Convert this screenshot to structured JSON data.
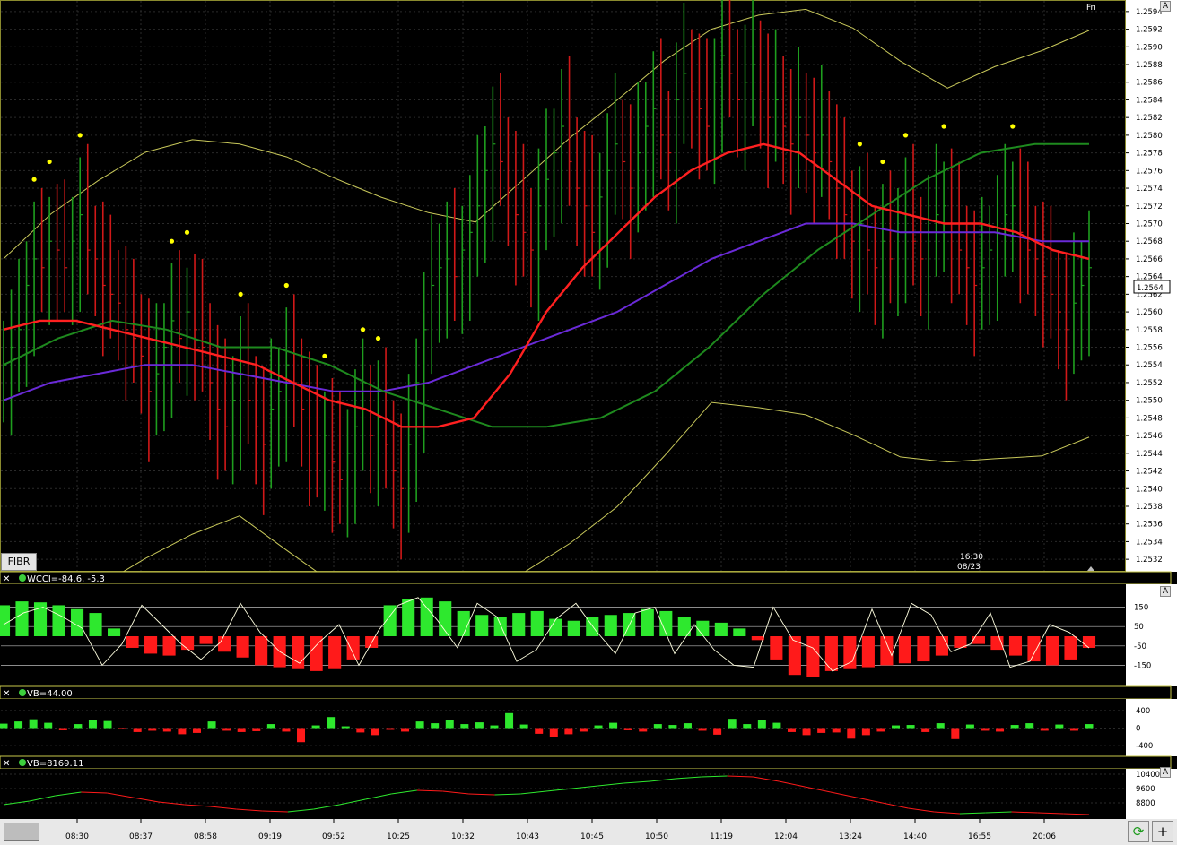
{
  "toolbar": {
    "tab_label": "FIBR",
    "corner_label": "A",
    "day_label": "Fri",
    "refresh_icon": "refresh-icon",
    "plus_label": "+"
  },
  "cursor": {
    "time": "16:30",
    "date": "08/23",
    "price_marker": "1.2564"
  },
  "colors": {
    "background": "#000000",
    "grid": "#2a2a2a",
    "up_bar": "#1e9e1e",
    "down_bar": "#d01818",
    "fast_ma": "#ff2020",
    "slow_ma": "#1e8a1e",
    "long_ma": "#6a2ad8",
    "bands": "#c8c85a",
    "dots": "#ffff00",
    "cci_line": "#ffffe0",
    "hist_up": "#2ee82e",
    "hist_down": "#ff1a1a"
  },
  "chart_data": [
    {
      "type": "line",
      "name": "price",
      "y_ticks": [
        "1.2594",
        "1.2592",
        "1.2590",
        "1.2588",
        "1.2586",
        "1.2584",
        "1.2582",
        "1.2580",
        "1.2578",
        "1.2576",
        "1.2574",
        "1.2572",
        "1.2570",
        "1.2568",
        "1.2566",
        "1.2564",
        "1.2562",
        "1.2560",
        "1.2558",
        "1.2556",
        "1.2554",
        "1.2552",
        "1.2550",
        "1.2548",
        "1.2546",
        "1.2544",
        "1.2542",
        "1.2540",
        "1.2538",
        "1.2536",
        "1.2534",
        "1.2532"
      ],
      "x_ticks": [
        "08:30",
        "08:37",
        "08:58",
        "09:19",
        "09:52",
        "10:25",
        "10:32",
        "10:43",
        "10:45",
        "10:50",
        "11:19",
        "12:04",
        "13:24",
        "14:40",
        "16:55",
        "20:06"
      ],
      "ylim": [
        1.2531,
        1.2595
      ],
      "close": [
        1.2554,
        1.2556,
        1.2558,
        1.2563,
        1.2566,
        1.2565,
        1.2568,
        1.2567,
        1.2565,
        1.2568,
        1.2571,
        1.2567,
        1.2566,
        1.2563,
        1.2562,
        1.2561,
        1.2558,
        1.2557,
        1.2555,
        1.2551,
        1.2553,
        1.2556,
        1.2559,
        1.2557,
        1.256,
        1.2558,
        1.2556,
        1.2552,
        1.2549,
        1.2547,
        1.255,
        1.2553,
        1.255,
        1.2547,
        1.2545,
        1.2549,
        1.2551,
        1.2554,
        1.2552,
        1.2549,
        1.2546,
        1.2544,
        1.2546,
        1.2543,
        1.2541,
        1.2544,
        1.2547,
        1.2549,
        1.2546,
        1.2548,
        1.2545,
        1.2542,
        1.254,
        1.2545,
        1.2552,
        1.2558,
        1.2563,
        1.2565,
        1.2566,
        1.2564,
        1.2567,
        1.2569,
        1.2572,
        1.2576,
        1.2579,
        1.2577,
        1.2574,
        1.2571,
        1.2569,
        1.2567,
        1.2572,
        1.2575,
        1.2578,
        1.2581,
        1.2577,
        1.2574,
        1.2572,
        1.2569,
        1.2573,
        1.2576,
        1.2579,
        1.2577,
        1.2574,
        1.2578,
        1.2581,
        1.2583,
        1.258,
        1.2578,
        1.2584,
        1.2587,
        1.2585,
        1.2583,
        1.2581,
        1.2586,
        1.2589,
        1.2587,
        1.2584,
        1.2586,
        1.2588,
        1.2585,
        1.2582,
        1.2584,
        1.2581,
        1.2579,
        1.2582,
        1.258,
        1.2578,
        1.258,
        1.2577,
        1.2574,
        1.2571,
        1.2568,
        1.257,
        1.2567,
        1.2565,
        1.2568,
        1.2566,
        1.2569,
        1.2571,
        1.2568,
        1.2566,
        1.2569,
        1.2571,
        1.2572,
        1.2569,
        1.2567,
        1.2565,
        1.2563,
        1.2565,
        1.2567,
        1.2569,
        1.2571,
        1.2572,
        1.2569,
        1.2567,
        1.2566,
        1.2564,
        1.2562,
        1.256,
        1.2558,
        1.2561,
        1.2563,
        1.2565
      ],
      "fast_ma": [
        1.2558,
        1.2559,
        1.2559,
        1.2558,
        1.2557,
        1.2556,
        1.2555,
        1.2554,
        1.2552,
        1.255,
        1.2549,
        1.2547,
        1.2547,
        1.2548,
        1.2553,
        1.256,
        1.2565,
        1.2569,
        1.2573,
        1.2576,
        1.2578,
        1.2579,
        1.2578,
        1.2575,
        1.2572,
        1.2571,
        1.257,
        1.257,
        1.2569,
        1.2567,
        1.2566
      ],
      "slow_ma": [
        1.2554,
        1.2557,
        1.2559,
        1.2558,
        1.2556,
        1.2556,
        1.2554,
        1.2551,
        1.2549,
        1.2547,
        1.2547,
        1.2548,
        1.2551,
        1.2556,
        1.2562,
        1.2567,
        1.2571,
        1.2575,
        1.2578,
        1.2579,
        1.2579
      ],
      "long_ma": [
        1.255,
        1.2552,
        1.2553,
        1.2554,
        1.2554,
        1.2553,
        1.2552,
        1.2551,
        1.2551,
        1.2552,
        1.2554,
        1.2556,
        1.2558,
        1.256,
        1.2563,
        1.2566,
        1.2568,
        1.257,
        1.257,
        1.2569,
        1.2569,
        1.2569,
        1.2568,
        1.2568
      ]
    },
    {
      "type": "bar",
      "name": "WCCI",
      "label": "WCCI=-84.6,  -5.3",
      "y_ticks": [
        "150",
        "50",
        "-50",
        "-150"
      ],
      "ylim": [
        -250,
        250
      ],
      "values": [
        160,
        180,
        175,
        160,
        140,
        120,
        40,
        -60,
        -90,
        -100,
        -70,
        -40,
        -80,
        -110,
        -150,
        -160,
        -170,
        -180,
        -170,
        -120,
        -60,
        160,
        190,
        200,
        180,
        130,
        110,
        100,
        120,
        130,
        90,
        80,
        100,
        110,
        120,
        140,
        130,
        100,
        80,
        70,
        40,
        -20,
        -120,
        -200,
        -210,
        -180,
        -170,
        -160,
        -150,
        -140,
        -130,
        -100,
        -60,
        -40,
        -70,
        -100,
        -130,
        -150,
        -120,
        -60
      ],
      "line": [
        60,
        120,
        150,
        100,
        40,
        -150,
        -40,
        160,
        60,
        -40,
        -120,
        -30,
        170,
        20,
        -80,
        -140,
        -30,
        60,
        -150,
        30,
        160,
        200,
        80,
        -60,
        170,
        100,
        -130,
        -70,
        90,
        170,
        30,
        -90,
        120,
        150,
        -90,
        60,
        -70,
        -150,
        -160,
        150,
        -20,
        -60,
        -180,
        -130,
        140,
        -100,
        170,
        110,
        -80,
        -40,
        120,
        -160,
        -130,
        60,
        20,
        -60
      ]
    },
    {
      "type": "bar",
      "name": "VB",
      "label": "VB=44.00",
      "y_ticks": [
        "400",
        "0",
        "-400"
      ],
      "ylim": [
        -600,
        600
      ],
      "values": [
        100,
        150,
        200,
        120,
        -50,
        90,
        180,
        160,
        -20,
        -90,
        -60,
        -80,
        -140,
        -110,
        150,
        -60,
        -90,
        -70,
        90,
        -80,
        -320,
        60,
        250,
        40,
        -100,
        -160,
        -40,
        -80,
        150,
        110,
        180,
        90,
        130,
        60,
        340,
        80,
        -130,
        -210,
        -140,
        -80,
        60,
        120,
        -50,
        -80,
        90,
        70,
        110,
        -60,
        -150,
        210,
        90,
        180,
        120,
        -90,
        -160,
        -110,
        -100,
        -240,
        -160,
        -80,
        60,
        70,
        -90,
        110,
        -250,
        80,
        -60,
        -80,
        70,
        110,
        -60,
        80,
        -60,
        90
      ]
    },
    {
      "type": "line",
      "name": "VB",
      "label": "VB=8169.11",
      "y_ticks": [
        "10400",
        "9600",
        "8800"
      ],
      "ylim": [
        8000,
        10600
      ],
      "values": [
        8700,
        8900,
        9200,
        9400,
        9350,
        9100,
        8850,
        8700,
        8600,
        8450,
        8350,
        8300,
        8450,
        8700,
        9000,
        9300,
        9500,
        9450,
        9300,
        9250,
        9300,
        9450,
        9600,
        9750,
        9900,
        10000,
        10150,
        10250,
        10300,
        10250,
        10000,
        9700,
        9400,
        9100,
        8800,
        8500,
        8300,
        8200,
        8250,
        8300,
        8250,
        8200,
        8150
      ]
    }
  ]
}
